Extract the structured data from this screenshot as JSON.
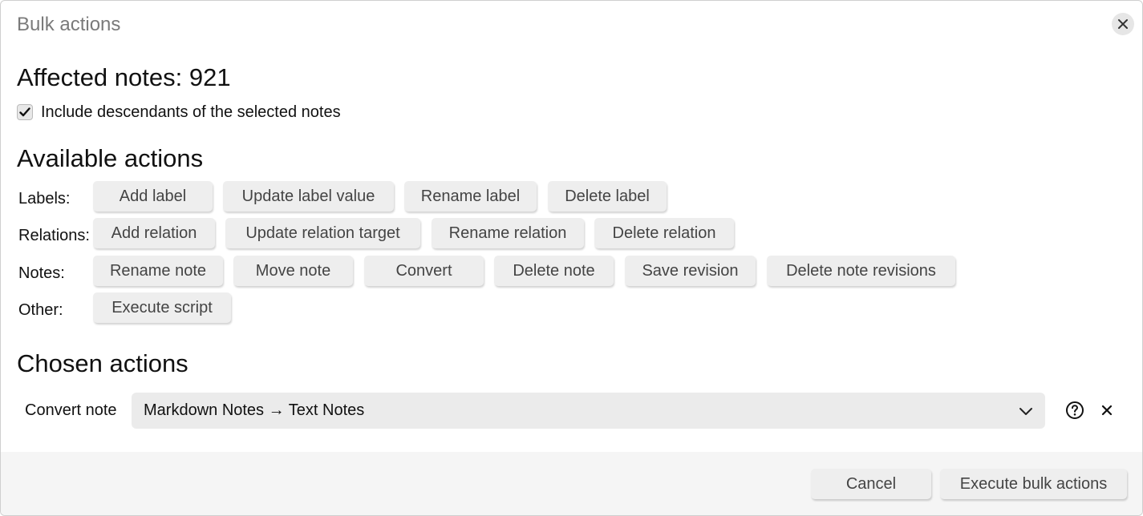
{
  "dialog": {
    "title": "Bulk actions",
    "affected_label": "Affected notes: 921",
    "include_descendants": {
      "label": "Include descendants of the selected notes",
      "checked": true
    }
  },
  "available": {
    "heading": "Available actions",
    "groups": [
      {
        "label": "Labels:",
        "actions": [
          "Add label",
          "Update label value",
          "Rename label",
          "Delete label"
        ]
      },
      {
        "label": "Relations:",
        "actions": [
          "Add relation",
          "Update relation target",
          "Rename relation",
          "Delete relation"
        ]
      },
      {
        "label": "Notes:",
        "actions": [
          "Rename note",
          "Move note",
          "Convert",
          "Delete note",
          "Save revision",
          "Delete note revisions"
        ]
      },
      {
        "label": "Other:",
        "actions": [
          "Execute script"
        ]
      }
    ]
  },
  "chosen": {
    "heading": "Chosen actions",
    "items": [
      {
        "label": "Convert note",
        "value": "Markdown Notes → Text Notes"
      }
    ]
  },
  "footer": {
    "cancel_label": "Cancel",
    "execute_label": "Execute bulk actions"
  }
}
